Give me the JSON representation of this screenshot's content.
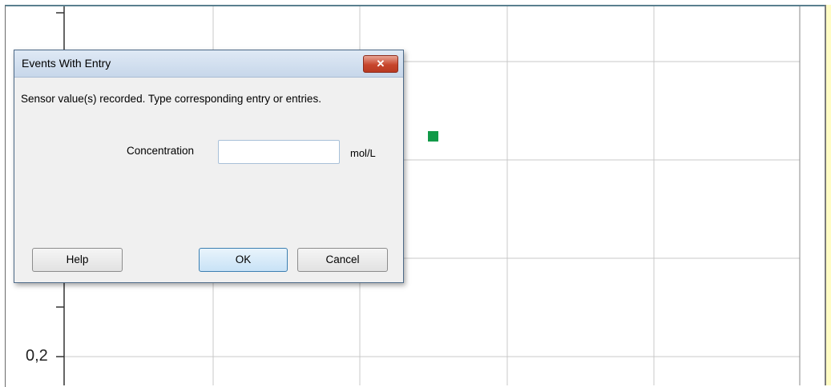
{
  "chart": {
    "y_tick_label": "0,2",
    "marker_color": "#119a48"
  },
  "dialog": {
    "title": "Events With Entry",
    "close_glyph": "✕",
    "message": "Sensor value(s) recorded. Type corresponding entry or entries.",
    "field_label": "Concentration",
    "field_value": "",
    "field_placeholder": "",
    "unit": "mol/L",
    "buttons": {
      "help": "Help",
      "ok": "OK",
      "cancel": "Cancel"
    }
  }
}
